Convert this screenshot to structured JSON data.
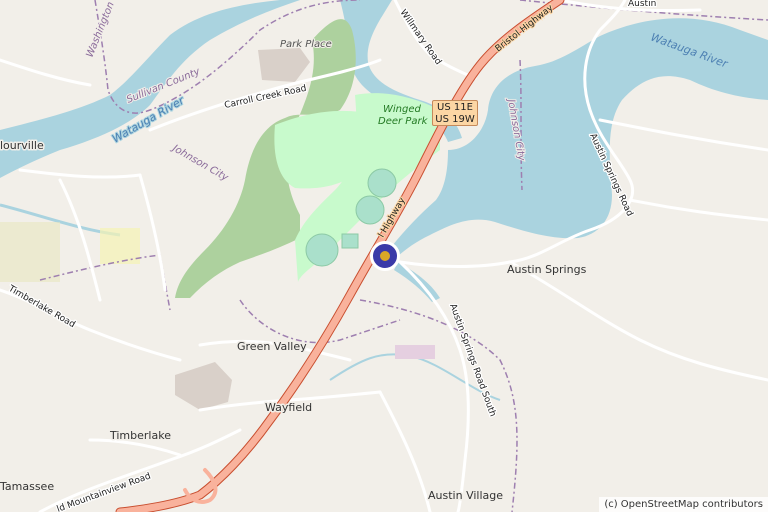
{
  "map": {
    "labels": {
      "washington_county": "Washington County",
      "sullivan_county": "Sullivan County",
      "watauga_river_west": "Watauga River",
      "watauga_river_east": "Watauga River",
      "johnson_city_west": "Johnson City",
      "johnson_city_east": "Johnson City",
      "park_place": "Park Place",
      "winged_deer_park": "Winged Deer Park",
      "bluff_city_partial": "lourville",
      "carroll_creek_road": "Carroll Creek Road",
      "bristol_highway_ne": "Bristol Highway",
      "bristol_highway_mid": "l Highway",
      "milligan_road": "Willmary Road",
      "austin_springs": "Austin Springs",
      "austin_springs_road": "Austin Springs Road",
      "austin_springs_road_south": "Austin Springs Road South",
      "timberlake_road": "Timberlake Road",
      "green_valley": "Green Valley",
      "wayfield": "Wayfield",
      "timberlake": "Timberlake",
      "old_mountainview_road": "ld Mountainview Road",
      "tamassee": "Tamassee",
      "austin_village": "Austin Village",
      "austin_top_partial": "Austin"
    },
    "shield": {
      "line1": "US 11E",
      "line2": "US 19W"
    },
    "attribution": "(c) OpenStreetMap contributors",
    "colors": {
      "land": "#f2efe9",
      "water": "#aad3df",
      "forest": "#add19e",
      "park": "#c8facc",
      "trunk_road": "#f9b29c",
      "trunk_casing": "#c84e2f",
      "minor_road": "#ffffff",
      "admin_boundary": "#9e7fb0",
      "marker_outer": "#3a3aa8",
      "marker_inner": "#d9a828"
    }
  }
}
